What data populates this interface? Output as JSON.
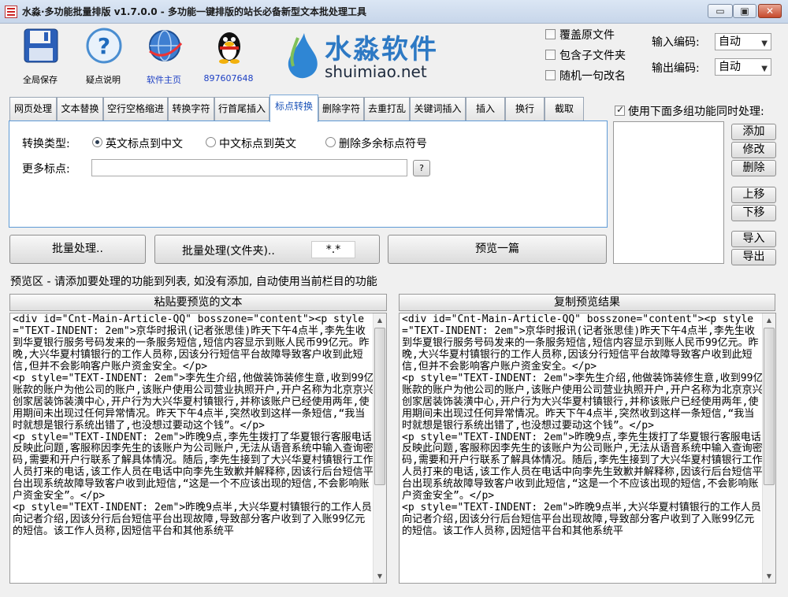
{
  "window": {
    "title": "水淼·多功能批量排版 v1.7.0.0 - 多功能一键排版的站长必备新型文本批处理工具",
    "min": "▭",
    "max": "▣",
    "close": "✕"
  },
  "toolbar": {
    "items": [
      {
        "label": "全局保存",
        "icon": "floppy-disk-icon"
      },
      {
        "label": "疑点说明",
        "icon": "help-icon"
      },
      {
        "label": "软件主页",
        "icon": "globe-icon"
      },
      {
        "label": "897607648",
        "icon": "qq-penguin-icon"
      }
    ]
  },
  "logo": {
    "main": "水淼软件",
    "sub": "shuimiao.net"
  },
  "options": {
    "overwrite": "覆盖原文件",
    "include_subfolders": "包含子文件夹",
    "random_rename": "随机一句改名",
    "input_encoding_label": "输入编码:",
    "input_encoding_value": "自动",
    "output_encoding_label": "输出编码:",
    "output_encoding_value": "自动"
  },
  "tabs": [
    "网页处理",
    "文本替换",
    "空行空格缩进",
    "转换字符",
    "行首尾插入",
    "标点转换",
    "删除字符",
    "去重打乱",
    "关键词插入",
    "插入",
    "换行",
    "截取"
  ],
  "active_tab": "标点转换",
  "panel": {
    "type_label": "转换类型:",
    "radio1": "英文标点到中文",
    "radio2": "中文标点到英文",
    "radio3": "删除多余标点符号",
    "more_label": "更多标点:",
    "more_value": "",
    "help_btn": "?"
  },
  "multi": {
    "checkbox_label": "使用下面多组功能同时处理:",
    "add": "添加",
    "edit": "修改",
    "delete": "删除",
    "up": "上移",
    "down": "下移",
    "import": "导入",
    "export": "导出"
  },
  "actions": {
    "batch": "批量处理..",
    "batch_folder": "批量处理(文件夹)..",
    "filter": "*.*",
    "preview": "预览一篇"
  },
  "preview": {
    "hint": "预览区 - 请添加要处理的功能到列表, 如没有添加, 自动使用当前栏目的功能",
    "left_title": "粘贴要预览的文本",
    "right_title": "复制预览结果",
    "left_text": "<div id=\"Cnt-Main-Article-QQ\" bosszone=\"content\"><p style=\"TEXT-INDENT: 2em\">京华时报讯(记者张思佳)昨天下午4点半,李先生收到华夏银行服务号码发来的一条服务短信,短信内容显示到账人民币99亿元。昨晚,大兴华夏村镇银行的工作人员称,因该分行短信平台故障导致客户收到此短信,但并不会影响客户账户资金安全。</p>\n<p style=\"TEXT-INDENT: 2em\">李先生介绍,他做装饰装修生意,收到99亿账款的账户为他公司的账户,该账户使用公司营业执照开户,开户名称为北京京兴创家居装饰装潢中心,开户行为大兴华夏村镇银行,并称该账户已经使用两年,使用期间未出现过任何异常情况。昨天下午4点半,突然收到这样一条短信,“我当时就想是银行系统出错了,也没想过要动这个钱”。</p>\n<p style=\"TEXT-INDENT: 2em\">昨晚9点,李先生拨打了华夏银行客服电话反映此问题,客服称因李先生的该账户为公司账户,无法从语音系统中输入查询密码,需要和开户行联系了解具体情况。随后,李先生接到了大兴华夏村镇银行工作人员打来的电话,该工作人员在电话中向李先生致歉并解释称,因该行后台短信平台出现系统故障导致客户收到此短信,“这是一个不应该出现的短信,不会影响账户资金安全”。</p>\n<p style=\"TEXT-INDENT: 2em\">昨晚9点半,大兴华夏村镇银行的工作人员向记者介绍,因该分行后台短信平台出现故障,导致部分客户收到了入账99亿元的短信。该工作人员称,因短信平台和其他系统平",
    "right_text": "<div id=\"Cnt-Main-Article-QQ\" bosszone=\"content\"><p style=\"TEXT-INDENT: 2em\">京华时报讯(记者张思佳)昨天下午4点半,李先生收到华夏银行服务号码发来的一条服务短信,短信内容显示到账人民币99亿元。昨晚,大兴华夏村镇银行的工作人员称,因该分行短信平台故障导致客户收到此短信,但并不会影响客户账户资金安全。</p>\n<p style=\"TEXT-INDENT: 2em\">李先生介绍,他做装饰装修生意,收到99亿账款的账户为他公司的账户,该账户使用公司营业执照开户,开户名称为北京京兴创家居装饰装潢中心,开户行为大兴华夏村镇银行,并称该账户已经使用两年,使用期间未出现过任何异常情况。昨天下午4点半,突然收到这样一条短信,“我当时就想是银行系统出错了,也没想过要动这个钱”。</p>\n<p style=\"TEXT-INDENT: 2em\">昨晚9点,李先生拨打了华夏银行客服电话反映此问题,客服称因李先生的该账户为公司账户,无法从语音系统中输入查询密码,需要和开户行联系了解具体情况。随后,李先生接到了大兴华夏村镇银行工作人员打来的电话,该工作人员在电话中向李先生致歉并解释称,因该行后台短信平台出现系统故障导致客户收到此短信,“这是一个不应该出现的短信,不会影响账户资金安全”。</p>\n<p style=\"TEXT-INDENT: 2em\">昨晚9点半,大兴华夏村镇银行的工作人员向记者介绍,因该分行后台短信平台出现故障,导致部分客户收到了入账99亿元的短信。该工作人员称,因短信平台和其他系统平"
  }
}
